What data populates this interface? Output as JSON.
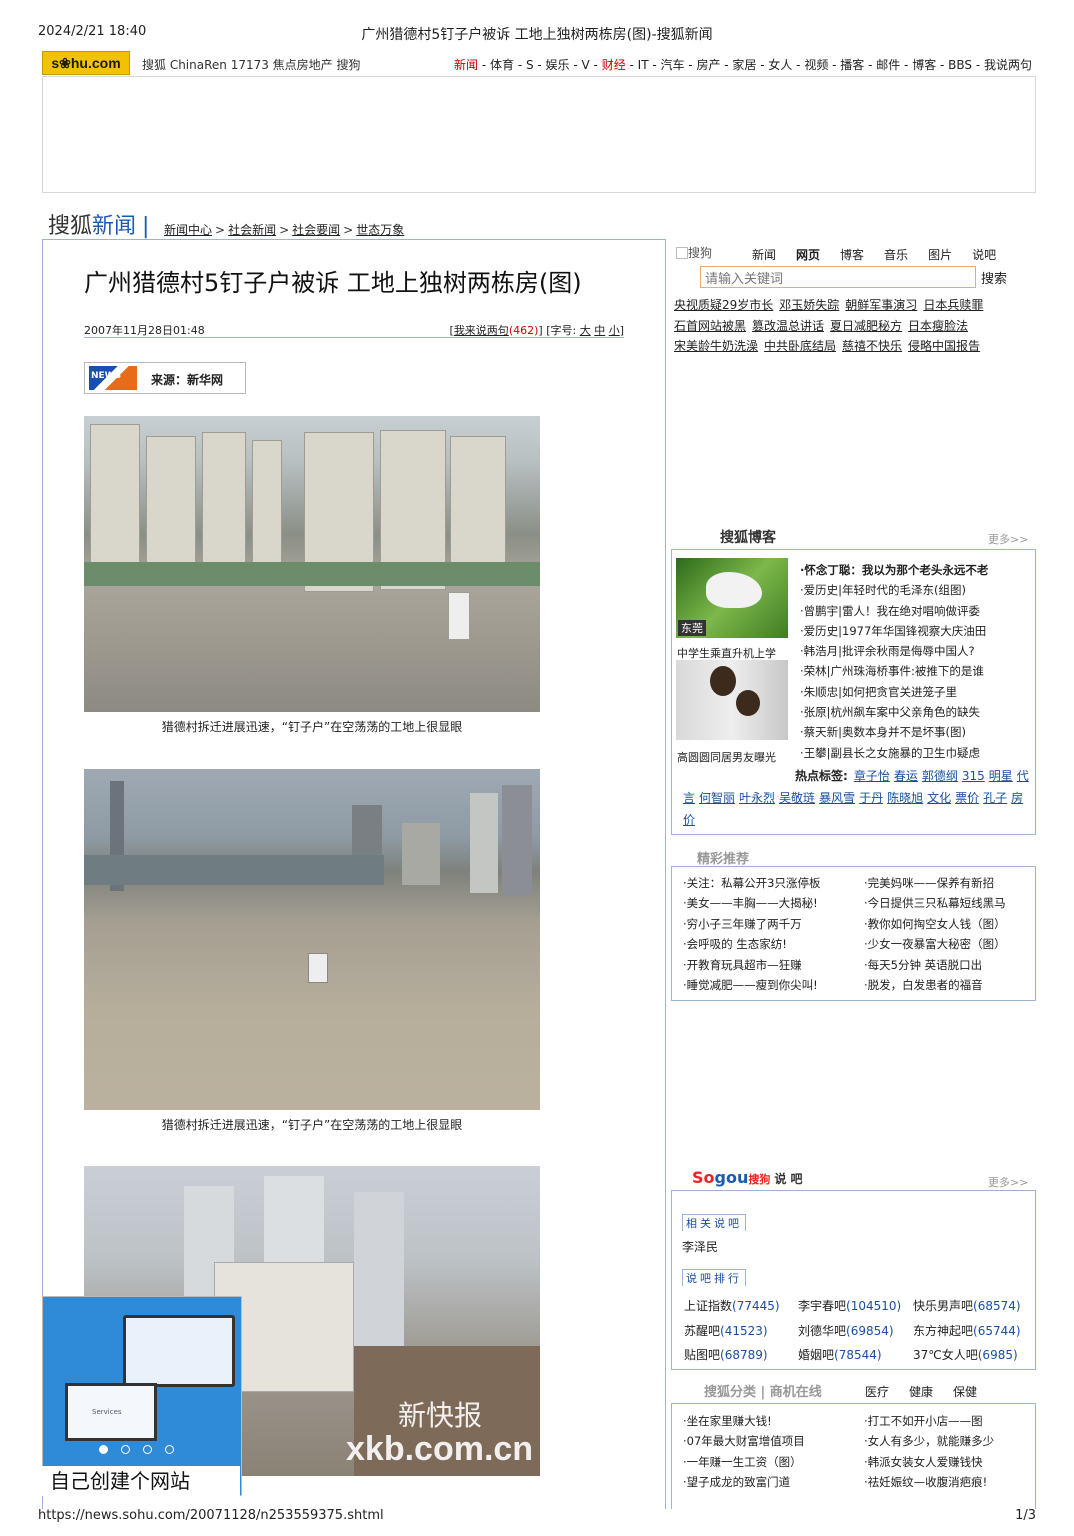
{
  "header": {
    "date": "2024/2/21 18:40",
    "title": "广州猎德村5钉子户被诉 工地上独树两栋房(图)-搜狐新闻"
  },
  "topbar": {
    "logo": "s❀hu.com",
    "links": "搜狐 ChinaRen 17173 焦点房地产 搜狗",
    "nav": [
      {
        "t": "新闻",
        "red": true
      },
      {
        "t": " - 体育 - S - 娱乐 - V - "
      },
      {
        "t": "财经",
        "red": true
      },
      {
        "t": " - IT - 汽车 - 房产 - 家居 - 女人 - 视频 - 播客 - 邮件 - 博客 - BBS - 我说两句"
      }
    ]
  },
  "brand": {
    "a": "搜狐",
    "b": "新闻"
  },
  "breadcrumb": [
    "新闻中心",
    "社会新闻",
    "社会要闻",
    "世态万象"
  ],
  "article": {
    "title": "广州猎德村5钉子户被诉 工地上独树两栋房(图)",
    "date": "2007年11月28日01:48",
    "comment_pre": "[",
    "comment_link": "我来说两句",
    "comment_count": "(462)",
    "comment_post": "]",
    "font_label": "[字号:",
    "font_big": "大",
    "font_mid": "中",
    "font_small": "小",
    "font_end": "]",
    "source": "来源：新华网",
    "source_logo": "NEWS",
    "captions": [
      "猎德村拆迁进展迅速，“钉子户”在空荡荡的工地上很显眼",
      "猎德村拆迁进展迅速，“钉子户”在空荡荡的工地上很显眼"
    ],
    "watermark": "新快报",
    "watermark2": "xkb.com.cn"
  },
  "float_ad": {
    "caption": "自己创建个网站",
    "screen_text": "Services"
  },
  "search": {
    "logo": "搜狗",
    "tabs": [
      "新闻",
      "网页",
      "博客",
      "音乐",
      "图片",
      "说吧"
    ],
    "placeholder": "请输入关键词",
    "button": "搜索",
    "hot": [
      [
        "央视质疑29岁市长",
        "邓玉娇失踪",
        "朝鲜军事演习",
        "日本兵赎罪"
      ],
      [
        "石首网站被黑",
        "篡改温总讲话",
        "夏日减肥秘方",
        "日本瘦脸法"
      ],
      [
        "宋美龄牛奶洗澡",
        "中共卧底结局",
        "慈禧不快乐",
        "侵略中国报告"
      ]
    ]
  },
  "blog": {
    "title": "搜狐博客",
    "more": "更多>>",
    "img1_tag": "东莞",
    "img1_caption": "中学生乘直升机上学",
    "img2_caption": "高圆圆同居男友曝光",
    "items": [
      "·怀念丁聪：我以为那个老头永远不老",
      "·爱历史|年轻时代的毛泽东(组图)",
      "·曾鹏宇|雷人！我在绝对唱响做评委",
      "·爱历史|1977年华国锋视察大庆油田",
      "·韩浩月|批评余秋雨是侮辱中国人?",
      "·荣林|广州珠海桥事件:被推下的是谁",
      "·朱顺忠|如何把贪官关进笼子里",
      "·张原|杭州飙车案中父亲角色的缺失",
      "·蔡天新|奥数本身并不是坏事(图)",
      "·王攀|副县长之女施暴的卫生巾疑虑"
    ],
    "tags_label": "热点标签:",
    "tags": [
      "章子怡",
      "春运",
      "郭德纲",
      "315",
      "明星",
      "代言",
      "何智丽",
      "叶永烈",
      "吴敬琏",
      "暴风雪",
      "于丹",
      "陈晓旭",
      "文化",
      "票价",
      "孔子",
      "房价"
    ]
  },
  "recommend": {
    "title": "精彩推荐",
    "left": [
      "·关注：私幕公开3只涨停板",
      "·美女——丰胸——大揭秘!",
      "·穷小子三年赚了两千万",
      "·会呼吸的 生态家纺!",
      "·开教育玩具超市—狂赚",
      "·睡觉减肥——瘦到你尖叫!"
    ],
    "right": [
      "·完美妈咪——保养有新招",
      "·今日提供三只私幕短线黑马",
      "·教你如何掏空女人钱（图）",
      "·少女一夜暴富大秘密（图）",
      "·每天5分钟 英语脱口出",
      "·脱发，白发患者的福音"
    ]
  },
  "sayba": {
    "logo_a": "So",
    "logo_b": "gou",
    "logo_c": "搜狗",
    "logo_d": "说 吧",
    "more": "更多>>",
    "sub1": "相关说吧",
    "name": "李泽民",
    "sub2": "说吧排行",
    "rank": [
      [
        [
          "上证指数",
          "(77445)"
        ],
        [
          "苏醒吧",
          "(41523)"
        ],
        [
          "贴图吧",
          "(68789)"
        ]
      ],
      [
        [
          "李宇春吧",
          "(104510)"
        ],
        [
          "刘德华吧",
          "(69854)"
        ],
        [
          "婚姻吧",
          "(78544)"
        ]
      ],
      [
        [
          "快乐男声吧",
          "(68574)"
        ],
        [
          "东方神起吧",
          "(65744)"
        ],
        [
          "37℃女人吧",
          "(6985)"
        ]
      ]
    ]
  },
  "category": {
    "title": "搜狐分类 | 商机在线",
    "tabs": [
      "医疗",
      "健康",
      "保健"
    ],
    "left": [
      "·坐在家里赚大钱!",
      "·07年最大财富增值项目",
      "·一年赚一生工资（图）",
      "·望子成龙的致富门道"
    ],
    "right": [
      "·打工不如开小店——图",
      "·女人有多少，就能赚多少",
      "·韩派女装女人爱赚钱快",
      "·祛妊娠纹—收腹消疤痕!"
    ]
  },
  "footer": {
    "url": "https://news.sohu.com/20071128/n253559375.shtml",
    "page": "1/3"
  }
}
